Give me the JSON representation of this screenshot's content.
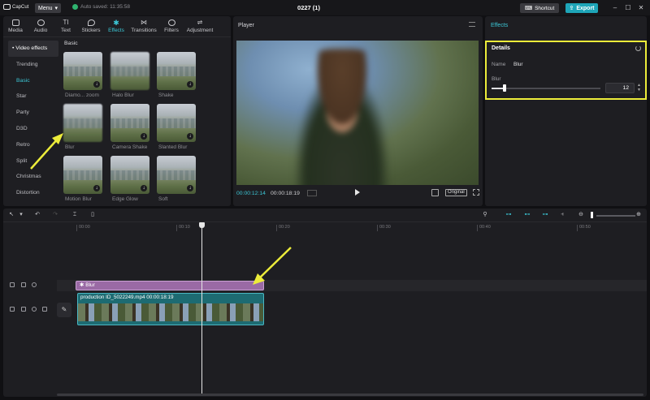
{
  "titlebar": {
    "logo": "CapCut",
    "menu": "Menu",
    "autosave": "Auto saved: 11:35:58",
    "project": "0227 (1)",
    "shortcut": "Shortcut",
    "export": "Export"
  },
  "toptabs": [
    {
      "label": "Media"
    },
    {
      "label": "Audio"
    },
    {
      "label": "Text"
    },
    {
      "label": "Stickers"
    },
    {
      "label": "Effects"
    },
    {
      "label": "Transitions"
    },
    {
      "label": "Filters"
    },
    {
      "label": "Adjustment"
    }
  ],
  "categories": [
    "• Video effects",
    "Trending",
    "Basic",
    "Star",
    "Party",
    "D3D",
    "Retro",
    "Split",
    "Christmas",
    "Distortion"
  ],
  "grid": {
    "section": "Basic",
    "effects": [
      "Diamo... zoom",
      "Halo Blur",
      "Shake",
      "Blur",
      "Camera Shake",
      "Slanted Blur",
      "Motion Blur",
      "Edge Glow",
      "Soft"
    ]
  },
  "player": {
    "title": "Player",
    "current_time": "00:00:12:14",
    "total_time": "00:00:18:19",
    "ratio": "Original"
  },
  "inspector": {
    "tab": "Effects",
    "details": "Details",
    "name_label": "Name",
    "name_value": "Blur",
    "blur_label": "Blur",
    "blur_value": "12",
    "blur_fraction": 0.12
  },
  "timeline": {
    "ruler": [
      "00:00",
      "00:10",
      "00:20",
      "00:30",
      "00:40",
      "00:50"
    ],
    "effect_clip": "Blur",
    "video_clip": "production ID_5022249.mp4   00:00:18:19"
  },
  "colors": {
    "accent": "#3cc7d6",
    "highlight": "#ecec3a",
    "effect_clip": "#9a6aa5",
    "video_clip": "#1d6b72"
  }
}
